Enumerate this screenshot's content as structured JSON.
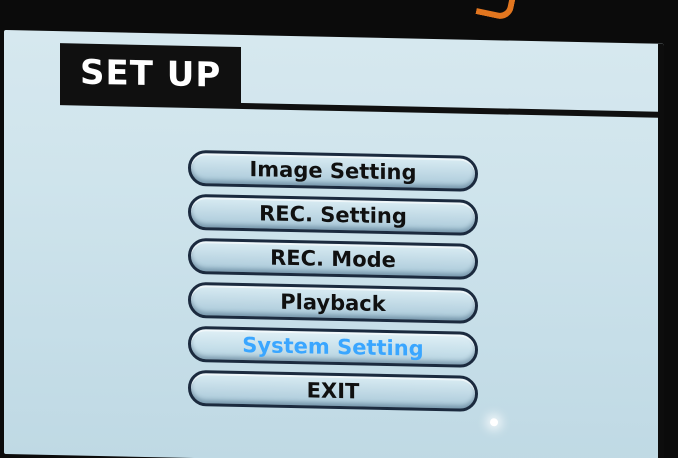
{
  "title": "SET UP",
  "menu": {
    "items": [
      {
        "label": "Image Setting",
        "selected": false
      },
      {
        "label": "REC. Setting",
        "selected": false
      },
      {
        "label": "REC. Mode",
        "selected": false
      },
      {
        "label": "Playback",
        "selected": false
      },
      {
        "label": "System Setting",
        "selected": true
      },
      {
        "label": "EXIT",
        "selected": false
      }
    ]
  },
  "colors": {
    "screen_bg": "#cfe4ec",
    "title_bg": "#101010",
    "title_text": "#ffffff",
    "button_border": "#1b2a3e",
    "selected_text": "#3aa6ff"
  }
}
